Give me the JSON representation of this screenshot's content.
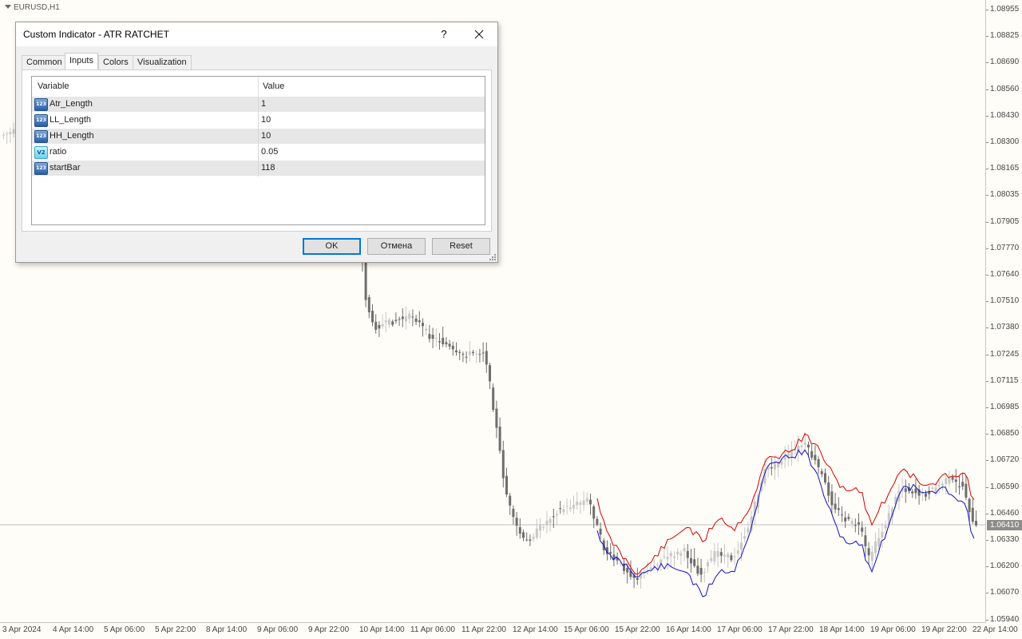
{
  "chart": {
    "symbol": "EURUSD,H1",
    "current_price": "1.06410",
    "price_ticks": [
      "1.08955",
      "1.08825",
      "1.08690",
      "1.08560",
      "1.08430",
      "1.08300",
      "1.08165",
      "1.08035",
      "1.07905",
      "1.07770",
      "1.07640",
      "1.07510",
      "1.07380",
      "1.07245",
      "1.07115",
      "1.06985",
      "1.06850",
      "1.06720",
      "1.06590",
      "1.06460",
      "1.06330",
      "1.06200",
      "1.06070",
      "1.05940"
    ],
    "time_ticks": [
      "3 Apr 2024",
      "4 Apr 14:00",
      "5 Apr 06:00",
      "5 Apr 22:00",
      "8 Apr 14:00",
      "9 Apr 06:00",
      "9 Apr 22:00",
      "10 Apr 14:00",
      "11 Apr 06:00",
      "11 Apr 22:00",
      "12 Apr 14:00",
      "15 Apr 06:00",
      "15 Apr 22:00",
      "16 Apr 14:00",
      "17 Apr 06:00",
      "17 Apr 22:00",
      "18 Apr 14:00",
      "19 Apr 06:00",
      "19 Apr 22:00",
      "22 Apr 14:00"
    ],
    "colors": {
      "bull": "#c8c8c8",
      "bear": "#6e6e6e",
      "red_line": "#d40000",
      "blue_line": "#1010c8",
      "current_line": "#c0c0c0"
    }
  },
  "dialog": {
    "title": "Custom Indicator - ATR RATCHET",
    "help_label": "?",
    "tabs": [
      {
        "label": "Common",
        "active": false
      },
      {
        "label": "Inputs",
        "active": true
      },
      {
        "label": "Colors",
        "active": false
      },
      {
        "label": "Visualization",
        "active": false
      }
    ],
    "grid": {
      "col_variable": "Variable",
      "col_value": "Value",
      "rows": [
        {
          "icon": "int-icon",
          "icon_text": "123",
          "name": "Atr_Length",
          "value": "1"
        },
        {
          "icon": "int-icon",
          "icon_text": "123",
          "name": "LL_Length",
          "value": "10"
        },
        {
          "icon": "int-icon",
          "icon_text": "123",
          "name": "HH_Length",
          "value": "10"
        },
        {
          "icon": "double-icon",
          "icon_text": "V2",
          "name": "ratio",
          "value": "0.05"
        },
        {
          "icon": "int-icon",
          "icon_text": "123",
          "name": "startBar",
          "value": "118"
        }
      ]
    },
    "buttons": {
      "ok": "OK",
      "cancel": "Отмена",
      "reset": "Reset"
    }
  }
}
